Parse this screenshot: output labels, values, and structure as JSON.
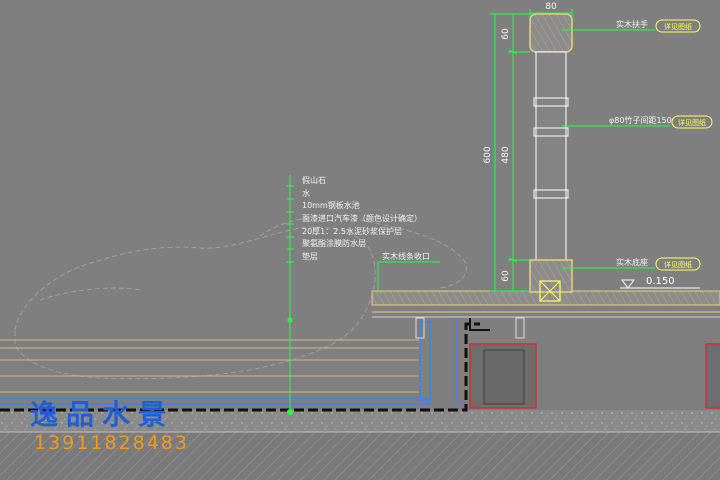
{
  "diagram": {
    "dimensions": {
      "top_width": "80",
      "rail_height": "60",
      "total_height": "600",
      "post_height": "480",
      "base_height": "60"
    },
    "callouts": [
      {
        "text": "实木扶手",
        "tag": "详见图纸"
      },
      {
        "text": "φ80竹子间距150",
        "tag": "详见图纸"
      },
      {
        "text": "实木底座",
        "tag": "详见图纸"
      }
    ],
    "layers": [
      "假山石",
      "水",
      "10mm钢板水池",
      "面漆进口汽车漆（颜色设计确定）",
      "20厚1：2.5水泥砂浆保护层",
      "聚氨酯涂膜防水层",
      "垫层"
    ],
    "edge_label": "实木线条收口",
    "elevation": "0.150",
    "colors": {
      "background": "#7f7f7f",
      "leader": "#22ff44",
      "wood": "#e6d27a",
      "wall": "#cc3333",
      "steel_plate": "#4f7fd8",
      "water_line": "#c9b98a"
    }
  },
  "watermark": {
    "title": "逸品水景",
    "phone": "13911828483"
  }
}
